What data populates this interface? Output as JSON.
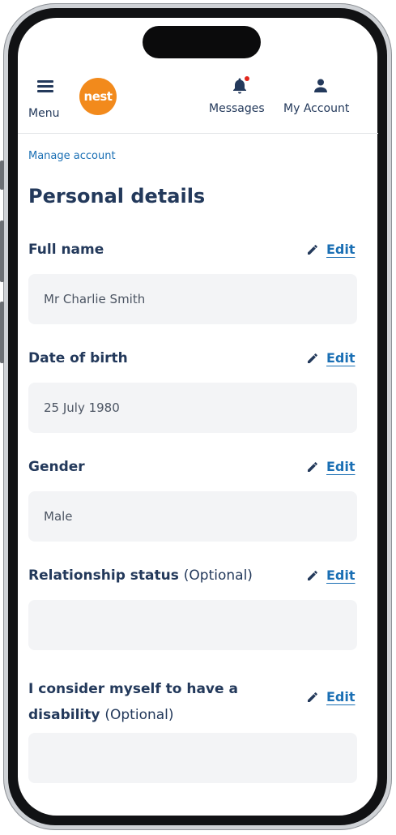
{
  "header": {
    "menu_label": "Menu",
    "logo_text": "nest",
    "messages_label": "Messages",
    "account_label": "My Account",
    "messages_icon": "bell-icon",
    "account_icon": "user-icon",
    "has_unread_messages": true
  },
  "breadcrumb": "Manage account",
  "page_title": "Personal details",
  "edit_label": "Edit",
  "fields": [
    {
      "label": "Full name",
      "optional": "",
      "value": "Mr Charlie Smith"
    },
    {
      "label": "Date of birth",
      "optional": "",
      "value": "25 July 1980"
    },
    {
      "label": "Gender",
      "optional": "",
      "value": "Male"
    },
    {
      "label": "Relationship status",
      "optional": "(Optional)",
      "value": ""
    },
    {
      "label_line1": "I consider myself to have a",
      "label_line2": "disability",
      "optional": "(Optional)",
      "value": ""
    }
  ],
  "colors": {
    "brand_orange": "#f28a1c",
    "heading_navy": "#23395b",
    "link_blue": "#1a6fb4",
    "field_bg": "#f3f4f6",
    "notification_red": "#e2261c"
  }
}
